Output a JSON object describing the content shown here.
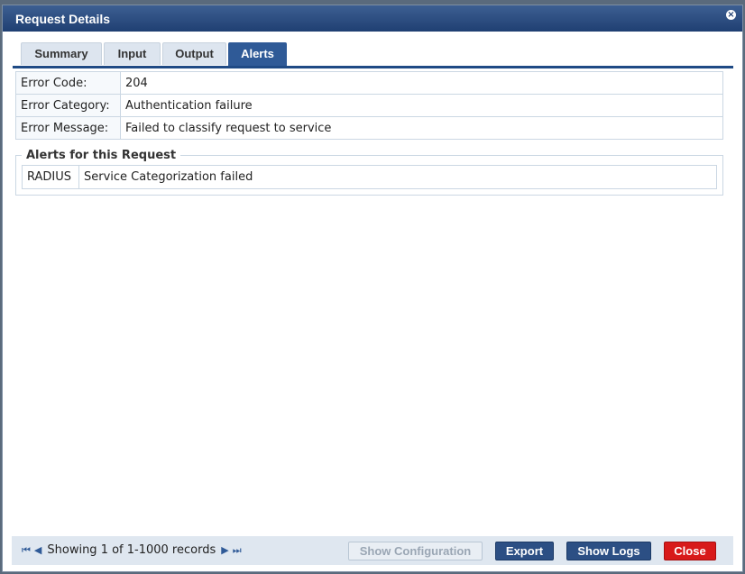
{
  "dialog": {
    "title": "Request Details",
    "close_glyph": "×"
  },
  "tabs": [
    {
      "label": "Summary",
      "active": false
    },
    {
      "label": "Input",
      "active": false
    },
    {
      "label": "Output",
      "active": false
    },
    {
      "label": "Alerts",
      "active": true
    }
  ],
  "details": [
    {
      "label": "Error Code:",
      "value": "204"
    },
    {
      "label": "Error Category:",
      "value": "Authentication failure"
    },
    {
      "label": "Error Message:",
      "value": "Failed to classify request to service"
    }
  ],
  "alerts": {
    "legend": "Alerts for this Request",
    "rows": [
      {
        "source": "RADIUS",
        "message": "Service Categorization failed"
      }
    ]
  },
  "footer": {
    "pager_text": "Showing 1 of 1-1000 records",
    "first_icon": "first-page-icon",
    "prev_icon": "prev-page-icon",
    "next_icon": "next-page-icon",
    "last_icon": "last-page-icon",
    "buttons": {
      "show_configuration": "Show Configuration",
      "export": "Export",
      "show_logs": "Show Logs",
      "close": "Close"
    }
  },
  "colors": {
    "title_bar": "#2a4a7f",
    "active_tab": "#2f5a97",
    "close_button": "#d81a1a"
  }
}
